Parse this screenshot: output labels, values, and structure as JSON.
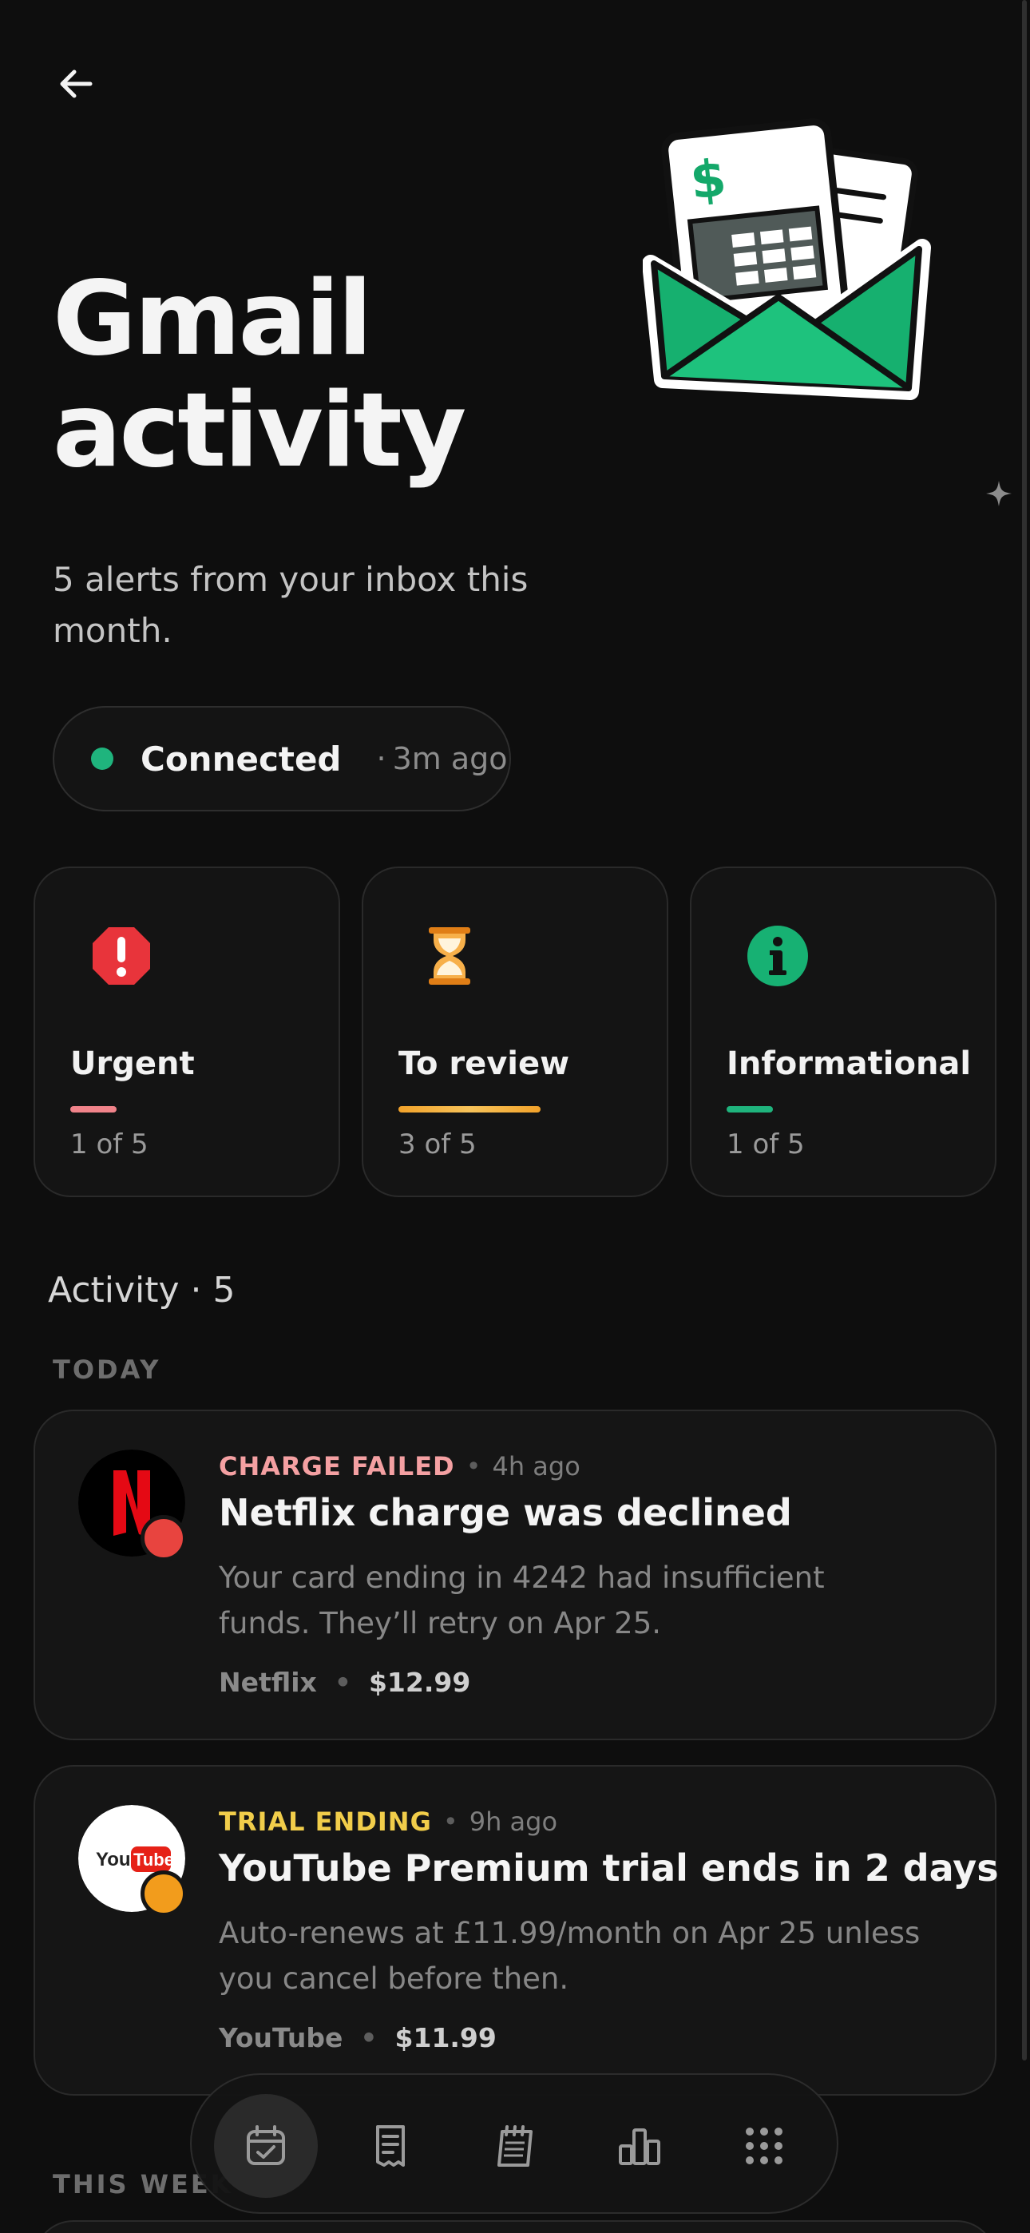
{
  "header": {
    "back_icon": "arrow-left-icon",
    "title_line1": "Gmail",
    "title_line2": "activity",
    "subtitle": "5 alerts from your inbox this month.",
    "illustration": "envelope-with-receipt-icon"
  },
  "status": {
    "label": "Connected",
    "separator": "·",
    "updated": "3m ago",
    "color": "#1fb47d"
  },
  "categories": [
    {
      "label": "Urgent",
      "count": "1 of 5",
      "icon": "exclamation-octagon-icon",
      "color": "#f0838a",
      "fraction": 0.2
    },
    {
      "label": "To review",
      "count": "3 of 5",
      "icon": "hourglass-icon",
      "color": "#f2a22a",
      "fraction": 0.6
    },
    {
      "label": "Informational",
      "count": "1 of 5",
      "icon": "info-circle-icon",
      "color": "#1fb47d",
      "fraction": 0.2
    }
  ],
  "activity": {
    "heading": "Activity · 5",
    "groups": [
      {
        "label": "TODAY"
      },
      {
        "label": "THIS WEEK"
      }
    ],
    "items": [
      {
        "tag": "CHARGE FAILED",
        "tag_color": "#f4a0a2",
        "time": "4h ago",
        "title": "Netflix charge was declined",
        "description": "Your card ending in 4242 had insufficient funds. They’ll retry on Apr 25.",
        "merchant": "Netflix",
        "amount": "$12.99",
        "avatar_icon": "netflix-logo-icon",
        "badge_color": "#e8443f"
      },
      {
        "tag": "TRIAL ENDING",
        "tag_color": "#f1cd4a",
        "time": "9h ago",
        "title": "YouTube Premium trial ends in 2 days",
        "description": "Auto-renews at £11.99/month on Apr 25 unless you cancel before then.",
        "merchant": "YouTube",
        "amount": "$11.99",
        "avatar_icon": "youtube-logo-icon",
        "badge_color": "#f29c1c"
      }
    ]
  },
  "nav": {
    "items": [
      {
        "icon": "calendar-check-icon",
        "active": true
      },
      {
        "icon": "receipt-icon",
        "active": false
      },
      {
        "icon": "notepad-icon",
        "active": false
      },
      {
        "icon": "bar-chart-icon",
        "active": false
      },
      {
        "icon": "grid-dots-icon",
        "active": false
      }
    ]
  },
  "misc": {
    "sparkle_icon": "sparkle-icon",
    "bullet": "•"
  }
}
